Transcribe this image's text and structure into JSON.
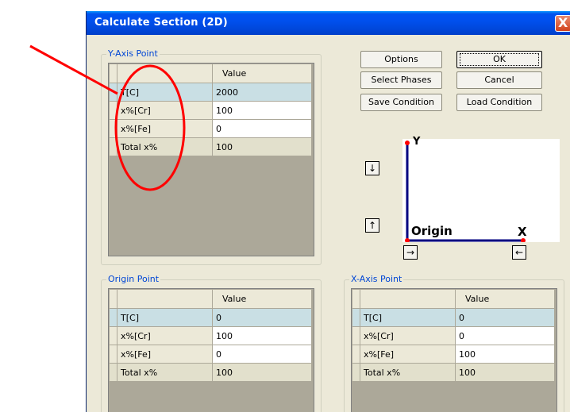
{
  "window": {
    "title": "Calculate Section (2D)",
    "close_glyph": "X"
  },
  "buttons": {
    "options": "Options",
    "ok": "OK",
    "select_phases": "Select Phases",
    "cancel": "Cancel",
    "save_condition": "Save Condition",
    "load_condition": "Load Condition"
  },
  "arrows": {
    "down": "↓",
    "up": "↑",
    "right": "→",
    "left": "←"
  },
  "preview": {
    "y_label": "Y",
    "x_label": "X",
    "origin_label": "Origin",
    "axis_color": "#000080",
    "point_color": "#ff0000"
  },
  "y_axis_point": {
    "title": "Y-Axis Point",
    "header_value": "Value",
    "rows": [
      {
        "label": "T[C]",
        "value": "2000"
      },
      {
        "label": "x%[Cr]",
        "value": "100"
      },
      {
        "label": "x%[Fe]",
        "value": "0"
      },
      {
        "label": "Total x%",
        "value": "100"
      }
    ]
  },
  "origin_point": {
    "title": "Origin Point",
    "header_value": "Value",
    "rows": [
      {
        "label": "T[C]",
        "value": "0"
      },
      {
        "label": "x%[Cr]",
        "value": "100"
      },
      {
        "label": "x%[Fe]",
        "value": "0"
      },
      {
        "label": "Total x%",
        "value": "100"
      }
    ]
  },
  "x_axis_point": {
    "title": "X-Axis Point",
    "header_value": "Value",
    "rows": [
      {
        "label": "T[C]",
        "value": "0"
      },
      {
        "label": "x%[Cr]",
        "value": "0"
      },
      {
        "label": "x%[Fe]",
        "value": "100"
      },
      {
        "label": "Total x%",
        "value": "100"
      }
    ]
  },
  "annotation": {
    "color": "#ff0000"
  }
}
